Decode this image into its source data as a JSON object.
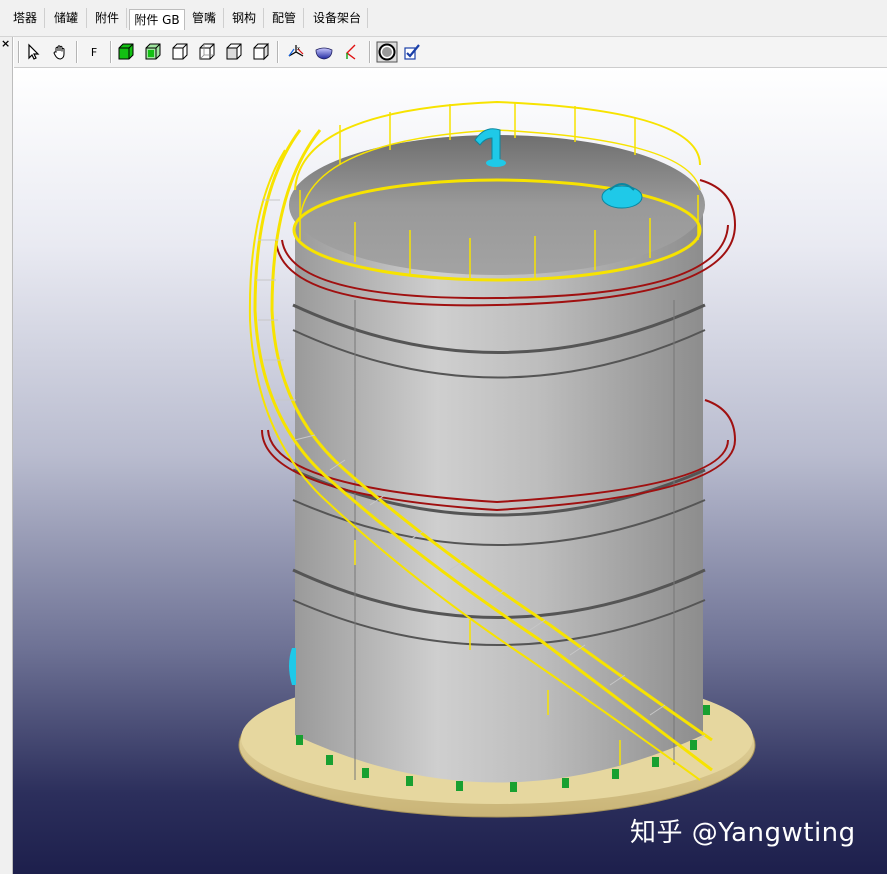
{
  "tabs": [
    "塔器",
    "储罐",
    "附件",
    "附件 GB",
    "管嘴",
    "钢构",
    "配管",
    "设备架台"
  ],
  "active_tab": "附件 GB",
  "panel": {
    "close_glyph": "×"
  },
  "toolbar": {
    "f_label": "F",
    "buttons": [
      "select-arrow-icon",
      "pan-hand-icon",
      "f-button",
      "solid-green-cube-icon",
      "green-cube-icon",
      "wireframe-cube-icon",
      "cube-outline-icon",
      "cube-front-icon",
      "cube-side-icon",
      "axis-xyz-icon",
      "hemisphere-shade-icon",
      "axis-angle-icon",
      "sphere-render-icon",
      "check-accept-icon"
    ]
  },
  "viewport": {
    "scene": "storage-tank-3d-model"
  },
  "watermark": "知乎 @Yangwting",
  "colors": {
    "stair_yellow": "#f7e300",
    "shell_grey": "#b7b7b7",
    "base_tan": "#e3d39a",
    "nozzle_cyan": "#1fc9e8",
    "ring_red": "#a01010",
    "bolt_green": "#18a030"
  }
}
